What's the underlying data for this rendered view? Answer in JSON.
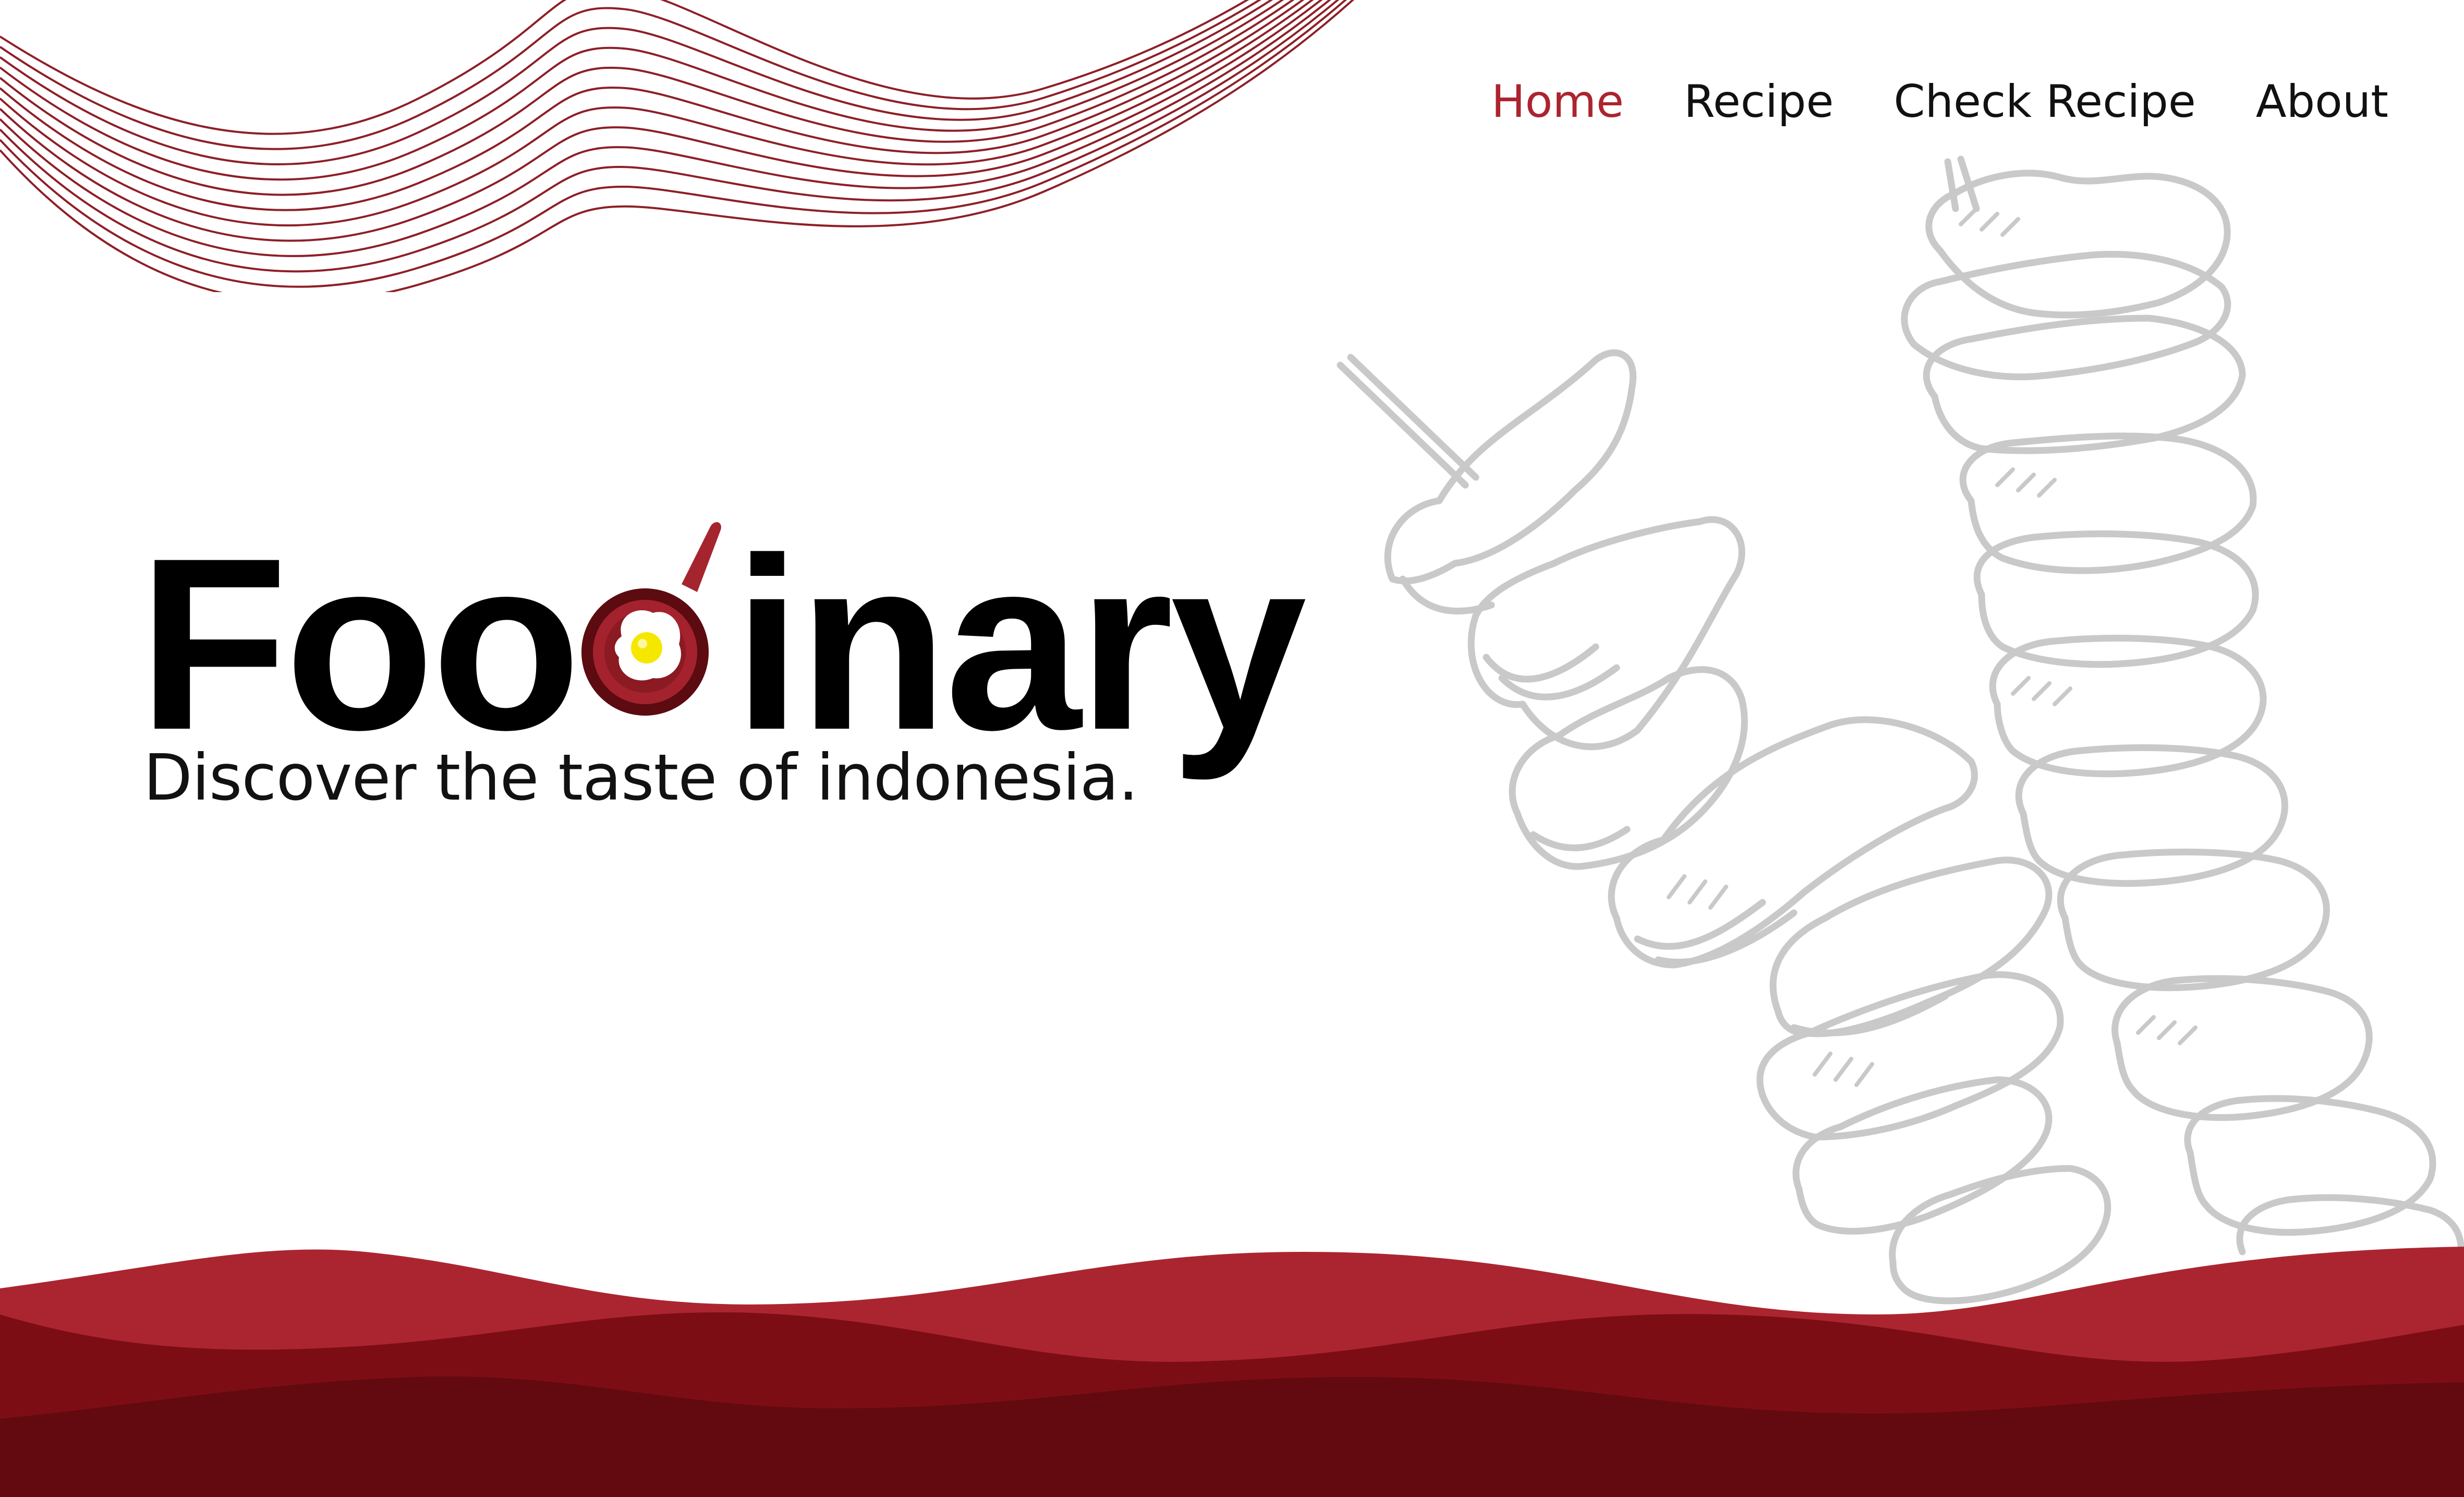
{
  "brand": {
    "name_before": "Foo",
    "name_after": "inary",
    "tagline": "Discover the taste of indonesia."
  },
  "nav": {
    "items": [
      {
        "label": "Home",
        "active": true
      },
      {
        "label": "Recipe",
        "active": false
      },
      {
        "label": "Check Recipe",
        "active": false
      },
      {
        "label": "About",
        "active": false
      }
    ]
  },
  "icons": {
    "logo_letter": "frying-pan-egg-icon",
    "illustration": "satay-skewer-illustration",
    "decor": "wave-lines-decoration"
  },
  "colors": {
    "accent": "#ab2430",
    "wave_light": "#ab2530",
    "wave_mid": "#7d0d14",
    "wave_dark": "#620a10",
    "outline": "#c9c9c9",
    "line": "#8e1f27"
  }
}
